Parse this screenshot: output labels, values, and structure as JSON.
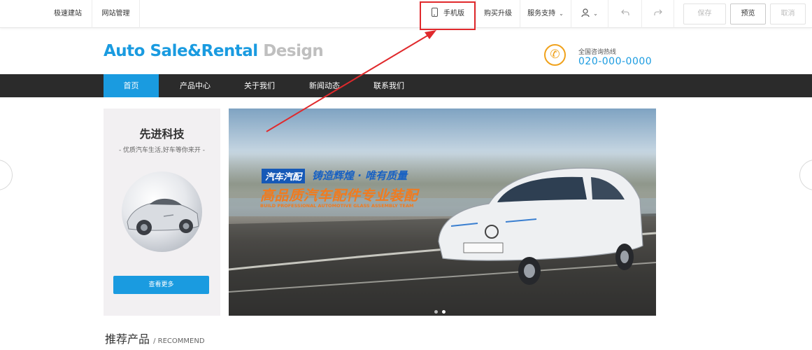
{
  "toolbar": {
    "left_items": [
      "极速建站",
      "网站管理"
    ],
    "mobile": "手机版",
    "buy": "购买升级",
    "support": "服务支持",
    "save": "保存",
    "preview": "预览",
    "cancel": "取消"
  },
  "header": {
    "logo_primary": "Auto Sale&Rental",
    "logo_secondary": "Design",
    "hotline_label": "全国咨询热线",
    "hotline_number": "020-000-0000"
  },
  "nav": {
    "items": [
      "首页",
      "产品中心",
      "关于我们",
      "新闻动态",
      "联系我们"
    ],
    "active_index": 0
  },
  "side_card": {
    "title": "先进科技",
    "subtitle": "- 优质汽车生活,好车等你来开 -",
    "button": "查看更多"
  },
  "banner": {
    "tag": "汽车汽配",
    "slogan": "铸造辉煌 · 唯有质量",
    "headline": "高品质汽车配件专业装配",
    "subline_en": "BUILD PROFESSIONAL AUTOMOTIVE GLASS ASSEMBLY TEAM",
    "slide_count": 2,
    "active_slide": 1
  },
  "section": {
    "title": "推荐产品",
    "title_en": "/ RECOMMEND"
  },
  "colors": {
    "brand_blue": "#1a9be0",
    "nav_dark": "#2b2b2b",
    "annotation_red": "#e0292c",
    "banner_orange": "#f07b1f"
  }
}
